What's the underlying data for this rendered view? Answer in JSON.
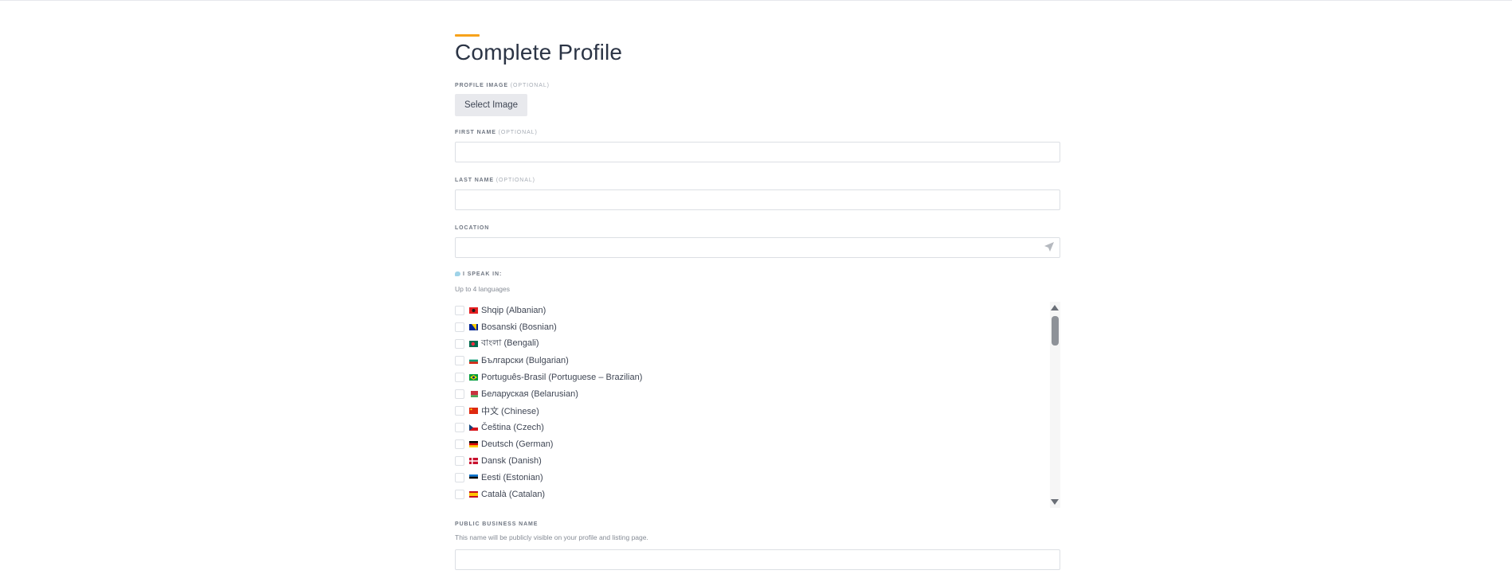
{
  "title": "Complete Profile",
  "profile_image": {
    "label": "PROFILE IMAGE",
    "optional": "(OPTIONAL)",
    "button": "Select Image"
  },
  "first_name": {
    "label": "FIRST NAME",
    "optional": "(OPTIONAL)",
    "value": ""
  },
  "last_name": {
    "label": "LAST NAME",
    "optional": "(OPTIONAL)",
    "value": ""
  },
  "location": {
    "label": "LOCATION",
    "value": "",
    "icon": "location-arrow-icon"
  },
  "languages": {
    "label": "I SPEAK IN:",
    "hint": "Up to 4 languages",
    "items": [
      {
        "label": "Shqip (Albanian)",
        "flag": "AL"
      },
      {
        "label": "Bosanski (Bosnian)",
        "flag": "BA"
      },
      {
        "label": "বাংলা (Bengali)",
        "flag": "BD"
      },
      {
        "label": "Български (Bulgarian)",
        "flag": "BG"
      },
      {
        "label": "Português-Brasil (Portuguese – Brazilian)",
        "flag": "BR"
      },
      {
        "label": "Беларуская (Belarusian)",
        "flag": "BY"
      },
      {
        "label": "中文 (Chinese)",
        "flag": "CN"
      },
      {
        "label": "Čeština (Czech)",
        "flag": "CZ"
      },
      {
        "label": "Deutsch (German)",
        "flag": "DE"
      },
      {
        "label": "Dansk (Danish)",
        "flag": "DK"
      },
      {
        "label": "Eesti (Estonian)",
        "flag": "EE"
      },
      {
        "label": "Català (Catalan)",
        "flag": "ES"
      }
    ]
  },
  "business_name": {
    "label": "PUBLIC BUSINESS NAME",
    "hint": "This name will be publicly visible on your profile and listing page.",
    "value": ""
  },
  "colors": {
    "accent": "#f7a21b",
    "title": "#2b3445",
    "border": "#dcdfe4"
  }
}
